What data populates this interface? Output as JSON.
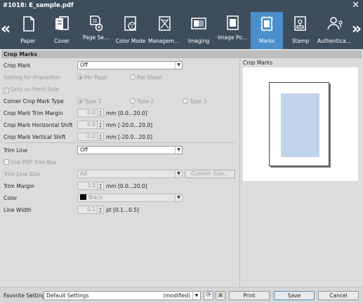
{
  "window": {
    "title": "#1018: E_sample.pdf",
    "close_icon": "close-icon"
  },
  "toolbar": {
    "tools": [
      {
        "label": "Paper",
        "icon": "paper-icon"
      },
      {
        "label": "Cover",
        "icon": "cover-icon"
      },
      {
        "label": "Page Settings",
        "icon": "page-settings-icon"
      },
      {
        "label": "Color Mode",
        "icon": "color-mode-icon"
      },
      {
        "label": "Management",
        "icon": "management-icon"
      },
      {
        "label": "Imaging",
        "icon": "imaging-icon"
      },
      {
        "label": "Image Position",
        "icon": "image-position-icon"
      },
      {
        "label": "Marks",
        "icon": "marks-icon",
        "active": true
      },
      {
        "label": "Stamp",
        "icon": "stamp-icon"
      },
      {
        "label": "Authenticat...",
        "icon": "authentication-icon"
      }
    ]
  },
  "section": {
    "title": "Crop Marks",
    "crop_mark_label": "Crop Mark",
    "crop_mark_value": "Off",
    "imposition_label": "Setting for Imposition",
    "imposition_opt1": "Per Page",
    "imposition_opt2": "Per Sheet",
    "front_side_label": "Only on Front Side",
    "corner_type_label": "Corner Crop Mark Type",
    "type1": "Type 1",
    "type2": "Type 2",
    "type3": "Type 3",
    "trim_margin_label": "Crop Mark Trim Margin",
    "trim_margin_value": "0.0",
    "trim_margin_unit": "mm [0.0...20.0]",
    "h_shift_label": "Crop Mark Horizontal Shift",
    "h_shift_value": "0.0",
    "h_shift_unit": "mm [-20.0...20.0]",
    "v_shift_label": "Crop Mark Vertical Shift",
    "v_shift_value": "0.0",
    "v_shift_unit": "mm [-20.0...20.0]",
    "trim_line_label": "Trim Line",
    "trim_line_value": "Off",
    "pdf_trim_label": "Use PDF Trim Box",
    "trim_size_label": "Trim Line Size",
    "trim_size_value": "A4",
    "custom_size_button": "Custom Size...",
    "trim_margin2_label": "Trim Margin",
    "trim_margin2_value": "3.0",
    "trim_margin2_unit": "mm [0.0...20.0]",
    "color_label": "Color",
    "color_value": "Black",
    "line_width_label": "Line Width",
    "line_width_value": "0.1",
    "line_width_unit": "pt [0.1...0.5]"
  },
  "preview": {
    "label": "Crop Marks"
  },
  "footer": {
    "favorite_label": "Favorite Setting",
    "favorite_value": "Default Settings",
    "modified": "(modified)",
    "print_button": "Print",
    "save_button": "Save",
    "cancel_button": "Cancel"
  }
}
